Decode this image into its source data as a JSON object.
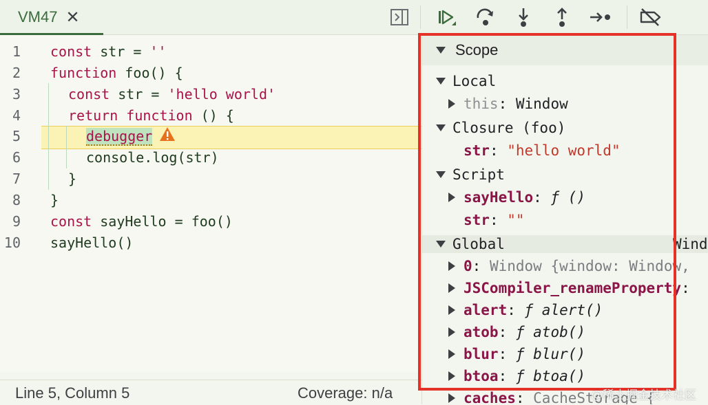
{
  "tab": {
    "label": "VM47",
    "close": "✕"
  },
  "toolbar": {
    "icons": [
      "toggle-sidebar-icon",
      "resume-icon",
      "step-over-icon",
      "step-into-icon",
      "step-out-icon",
      "step-icon",
      "deactivate-breakpoints-icon"
    ]
  },
  "editor": {
    "current_line": 5,
    "lines": [
      {
        "n": "1",
        "tokens": [
          [
            "kw",
            "const "
          ],
          [
            "id",
            "str = "
          ],
          [
            "str",
            "''"
          ]
        ]
      },
      {
        "n": "2",
        "tokens": [
          [
            "kw",
            "function "
          ],
          [
            "id",
            "foo() {"
          ]
        ]
      },
      {
        "n": "3",
        "tokens": [
          [
            "kw",
            "const "
          ],
          [
            "id",
            "str = "
          ],
          [
            "str",
            "'hello world'"
          ]
        ]
      },
      {
        "n": "4",
        "tokens": [
          [
            "kw",
            "return function "
          ],
          [
            "id",
            "() {"
          ]
        ]
      },
      {
        "n": "5",
        "tokens": [
          [
            "kw",
            "debugger"
          ]
        ]
      },
      {
        "n": "6",
        "tokens": [
          [
            "id",
            "console.log(str)"
          ]
        ]
      },
      {
        "n": "7",
        "tokens": [
          [
            "id",
            "}"
          ]
        ]
      },
      {
        "n": "8",
        "tokens": [
          [
            "id",
            "}"
          ]
        ]
      },
      {
        "n": "9",
        "tokens": [
          [
            "kw",
            "const "
          ],
          [
            "id",
            "sayHello = foo()"
          ]
        ]
      },
      {
        "n": "10",
        "tokens": [
          [
            "id",
            "sayHello()"
          ]
        ]
      }
    ],
    "warning_icon": "warning-icon"
  },
  "status": {
    "position": "Line 5, Column 5",
    "coverage": "Coverage: n/a"
  },
  "scope": {
    "title": "Scope",
    "local": {
      "label": "Local",
      "this_key": "this",
      "this_sep": ": ",
      "this_val": "Window"
    },
    "closure": {
      "label": "Closure (foo)",
      "str_key": "str",
      "str_sep": ": ",
      "str_val": "\"hello world\""
    },
    "script": {
      "label": "Script",
      "sayhello_key": "sayHello",
      "sayhello_sep": ": ",
      "sayhello_val": "ƒ ()",
      "str_key": "str",
      "str_sep": ": ",
      "str_val": "\"\""
    },
    "global": {
      "label": "Global",
      "right_text": "Wind",
      "items": [
        {
          "key": "0",
          "sep": ": ",
          "val": "Window {window: Window,",
          "dimkey": true
        },
        {
          "key": "JSCompiler_renameProperty",
          "sep": ":",
          "val": ""
        },
        {
          "key": "alert",
          "sep": ": ",
          "val": "ƒ alert()"
        },
        {
          "key": "atob",
          "sep": ": ",
          "val": "ƒ atob()"
        },
        {
          "key": "blur",
          "sep": ": ",
          "val": "ƒ blur()"
        },
        {
          "key": "btoa",
          "sep": ": ",
          "val": "ƒ btoa()"
        },
        {
          "key": "caches",
          "sep": ": ",
          "val": "CacheStorage {"
        }
      ]
    }
  },
  "watermark": "@稀土掘金技术社区",
  "colors": {
    "annotation": "#e53228",
    "accent": "#3b6b3b"
  }
}
